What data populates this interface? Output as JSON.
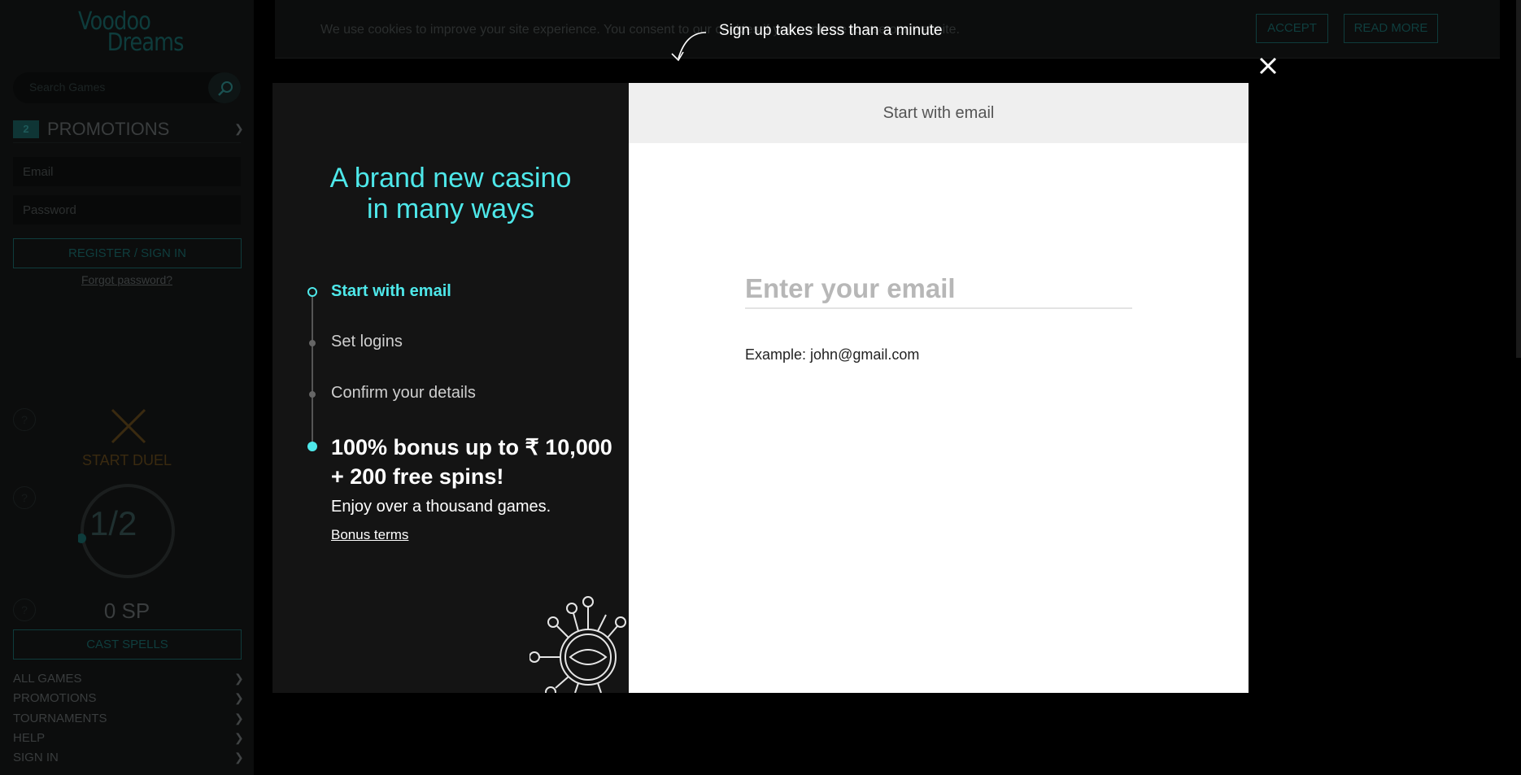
{
  "sidebar": {
    "logo_line1": "Voodoo",
    "logo_line2": "Dreams",
    "search_placeholder": "Search Games",
    "promotions_count": "2",
    "promotions_label": "PROMOTIONS",
    "email_placeholder": "Email",
    "password_placeholder": "Password",
    "register_label": "REGISTER / SIGN IN",
    "forgot_label": "Forgot password?",
    "duel_label": "START DUEL",
    "ring_value": "1/2",
    "sp_label": "0 SP",
    "cast_label": "CAST SPELLS",
    "nav": [
      "ALL GAMES",
      "PROMOTIONS",
      "TOURNAMENTS",
      "HELP",
      "SIGN IN"
    ]
  },
  "cookie": {
    "text": "We use cookies to improve your site experience. You consent to our cookies if you continue to use our website.",
    "accept_label": "ACCEPT",
    "read_more_label": "READ MORE"
  },
  "overlay": {
    "hint": "Sign up takes less than a minute"
  },
  "modal": {
    "headline_line1": "A brand new casino",
    "headline_line2": "in many ways",
    "steps": [
      "Start with email",
      "Set logins",
      "Confirm your details"
    ],
    "bonus_line1": "100% bonus up to ₹ 10,000",
    "bonus_line2": "+ 200 free spins!",
    "bonus_sub": "Enjoy over a thousand games.",
    "bonus_terms": "Bonus terms",
    "tab_title": "Start with email",
    "email_placeholder": "Enter your email",
    "email_example": "Example: john@gmail.com"
  },
  "colors": {
    "accent": "#4ee8ea",
    "modal_left_bg": "#141414",
    "modal_right_bg": "#ffffff",
    "tab_bg": "#efefef"
  }
}
